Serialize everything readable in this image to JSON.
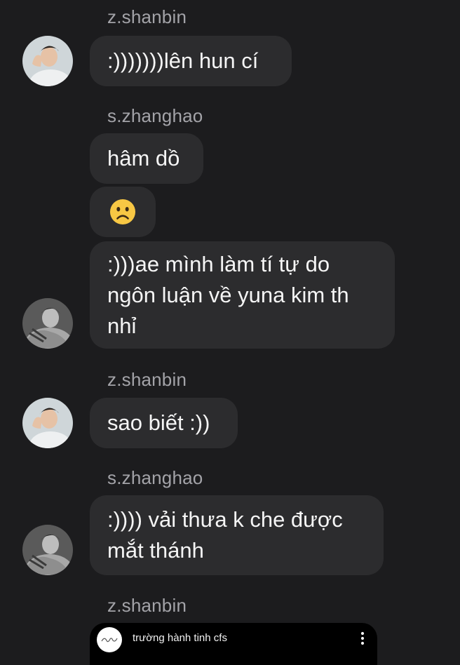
{
  "thread": [
    {
      "type": "sender",
      "text": "z.shanbin"
    },
    {
      "type": "message",
      "text": ":)))))))lên hun cí"
    },
    {
      "type": "sender",
      "text": "s.zhanghao"
    },
    {
      "type": "message",
      "text": "hâm dồ"
    },
    {
      "type": "emoji",
      "icon": "frowning-face-emoji"
    },
    {
      "type": "message",
      "text": ":)))ae mình làm tí tự do\nngôn luận về yuna kim th\nnhỉ"
    },
    {
      "type": "sender",
      "text": "z.shanbin"
    },
    {
      "type": "message",
      "text": "sao biết :))"
    },
    {
      "type": "sender",
      "text": "s.zhanghao"
    },
    {
      "type": "message",
      "text": ":)))) vải thưa k che được\nmắt thánh"
    },
    {
      "type": "sender",
      "text": "z.shanbin"
    }
  ],
  "shared_post": {
    "account": "trường hành tinh cfs",
    "icon": "more-vertical-icon"
  },
  "colors": {
    "background": "#1c1c1e",
    "bubble": "#2c2c2e",
    "sender_name": "#a3a3a8",
    "emoji_yellow": "#f7c744"
  }
}
